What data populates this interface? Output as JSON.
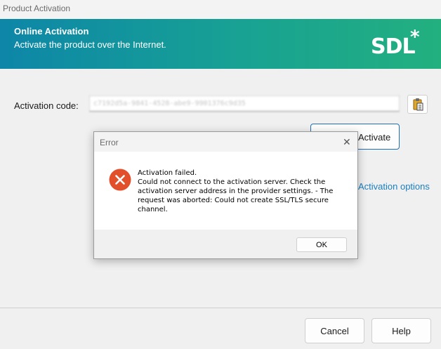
{
  "window": {
    "title": "Product Activation"
  },
  "banner": {
    "title": "Online Activation",
    "subtitle": "Activate the product over the Internet.",
    "logo_text": "SDL",
    "logo_star": "*"
  },
  "form": {
    "code_label": "Activation code:",
    "code_value": "c7192d5a-9841-4528-abe9-9901376c9d35",
    "paste_icon": "clipboard-paste-icon",
    "activate_label": "Activate",
    "options_link": "Activation options"
  },
  "footer": {
    "cancel_label": "Cancel",
    "help_label": "Help"
  },
  "error_dialog": {
    "title": "Error",
    "close_glyph": "✕",
    "icon": "error-icon",
    "message_title": "Activation failed.",
    "message_body": "Could not connect to the activation server. Check the activation server address in the provider settings. - The request was aborted: Could not create SSL/TLS secure channel.",
    "ok_label": "OK"
  },
  "colors": {
    "banner_start": "#0d86a8",
    "banner_end": "#22b07f",
    "link": "#1a7fc0",
    "error_red": "#e2502b",
    "focus_blue": "#1f6fb7"
  }
}
